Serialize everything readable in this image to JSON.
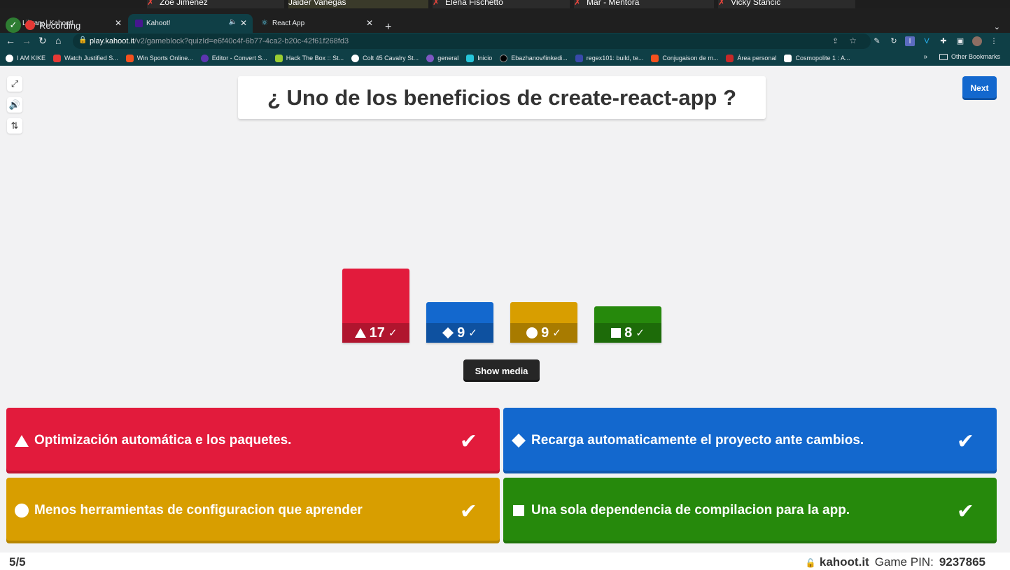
{
  "video_strip": {
    "tiles": [
      "Zoe Jimenez",
      "Jaider Vanegas",
      "Elena Fischetto",
      "Mar - Mentora",
      "Vicky Stancic"
    ]
  },
  "recording": {
    "label": "Recording"
  },
  "tabs": [
    {
      "label": "Library | Kahoot!",
      "active": false
    },
    {
      "label": "Kahoot!",
      "active": true
    },
    {
      "label": "React App",
      "active": false
    }
  ],
  "address": {
    "host": "play.kahoot.it",
    "path": "/v2/gameblock?quizId=e6f40c4f-6b77-4ca2-b20c-42f61f268fd3"
  },
  "bookmarks": [
    {
      "label": "I AM KIKE",
      "color": "#ffffff"
    },
    {
      "label": "Watch Justified S...",
      "color": "#e53935"
    },
    {
      "label": "Win Sports Online...",
      "color": "#f4511e"
    },
    {
      "label": "Editor - Convert S...",
      "color": "#5e35b1"
    },
    {
      "label": "Hack The Box :: St...",
      "color": "#9acd32"
    },
    {
      "label": "Colt 45 Cavalry St...",
      "color": "#ffffff"
    },
    {
      "label": "general",
      "color": "#7e57c2"
    },
    {
      "label": "Inicio",
      "color": "#26c6da"
    },
    {
      "label": "Ebazhanov/linkedi...",
      "color": "#000000"
    },
    {
      "label": "regex101: build, te...",
      "color": "#3949ab"
    },
    {
      "label": "Conjugaison de m...",
      "color": "#f4511e"
    },
    {
      "label": "Área personal",
      "color": "#c62828"
    },
    {
      "label": "Cosmopolite 1 : A...",
      "color": "#ffffff"
    }
  ],
  "bookmarks_other": "Other Bookmarks",
  "question": "¿ Uno de los beneficios de create-react-app ?",
  "next_label": "Next",
  "show_media_label": "Show media",
  "results": [
    {
      "shape": "triangle",
      "count": "17",
      "color": "#e21b3c",
      "value": 17
    },
    {
      "shape": "diamond",
      "count": "9",
      "color": "#1368ce",
      "value": 9
    },
    {
      "shape": "circle",
      "count": "9",
      "color": "#d89e00",
      "value": 9
    },
    {
      "shape": "square",
      "count": "8",
      "color": "#26890c",
      "value": 8
    }
  ],
  "answers": [
    {
      "shape": "triangle",
      "text": "Optimización automática e los paquetes.",
      "color": "#e21b3c",
      "correct": true
    },
    {
      "shape": "diamond",
      "text": "Recarga automaticamente el proyecto ante cambios.",
      "color": "#1368ce",
      "correct": true
    },
    {
      "shape": "circle",
      "text": "Menos herramientas de configuracion que aprender",
      "color": "#d89e00",
      "correct": true
    },
    {
      "shape": "square",
      "text": "Una sola dependencia de compilacion para la app.",
      "color": "#26890c",
      "correct": true
    }
  ],
  "footer": {
    "counter": "5/5",
    "brand": "kahoot.it",
    "pin_label": "Game PIN:",
    "pin": "9237865"
  }
}
